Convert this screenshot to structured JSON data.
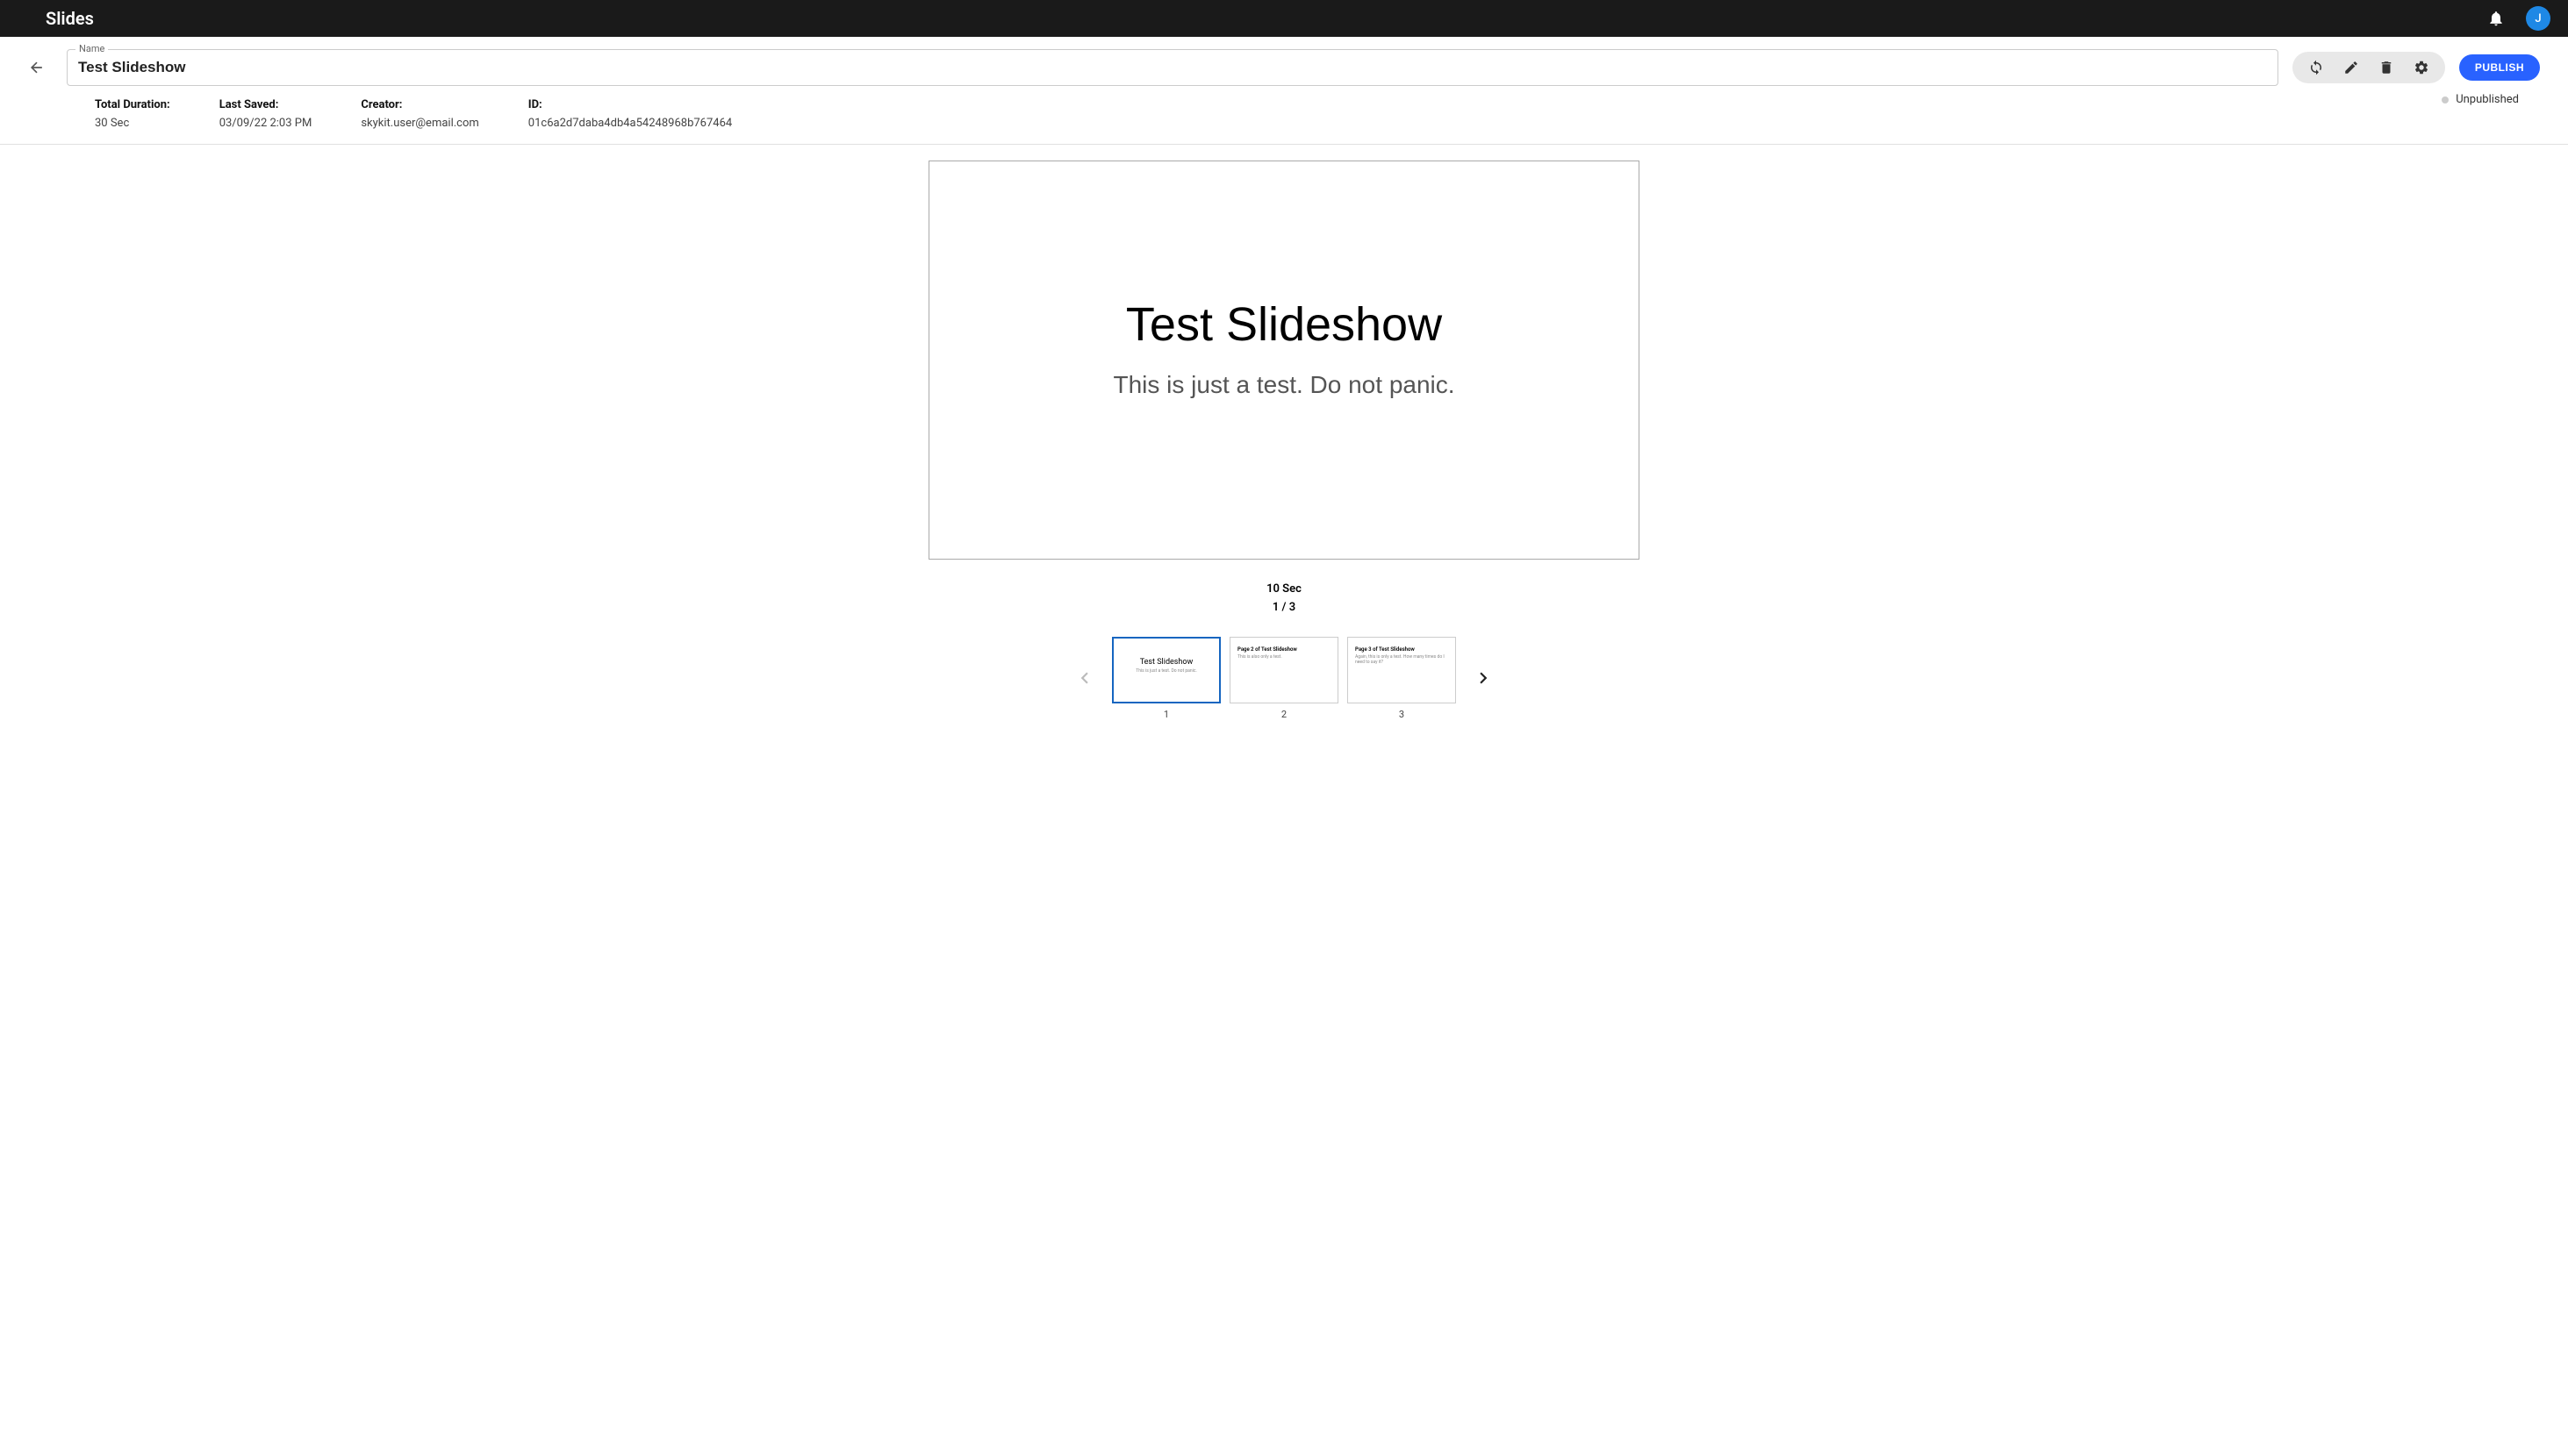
{
  "app": {
    "title": "Slides",
    "avatar_letter": "J"
  },
  "slideshow": {
    "name_label": "Name",
    "name": "Test Slideshow",
    "publish_label": "PUBLISH",
    "status": "Unpublished"
  },
  "meta": {
    "duration_label": "Total Duration:",
    "duration": "30 Sec",
    "last_saved_label": "Last Saved:",
    "last_saved": "03/09/22 2:03 PM",
    "creator_label": "Creator:",
    "creator": "skykit.user@email.com",
    "id_label": "ID:",
    "id": "01c6a2d7daba4db4a54248968b767464"
  },
  "current_slide": {
    "title": "Test Slideshow",
    "subtitle": "This is just a test. Do not panic.",
    "duration": "10 Sec",
    "position": "1 / 3"
  },
  "thumbnails": [
    {
      "title": "Test Slideshow",
      "subtitle": "This is just a test. Do not panic.",
      "number": "1",
      "active": true,
      "alt": false
    },
    {
      "title": "Page 2 of Test Slideshow",
      "subtitle": "This is also only a test.",
      "number": "2",
      "active": false,
      "alt": true
    },
    {
      "title": "Page 3 of Test Slideshow",
      "subtitle": "Again, this is only a test. How many times do I need to say it?",
      "number": "3",
      "active": false,
      "alt": true
    }
  ]
}
